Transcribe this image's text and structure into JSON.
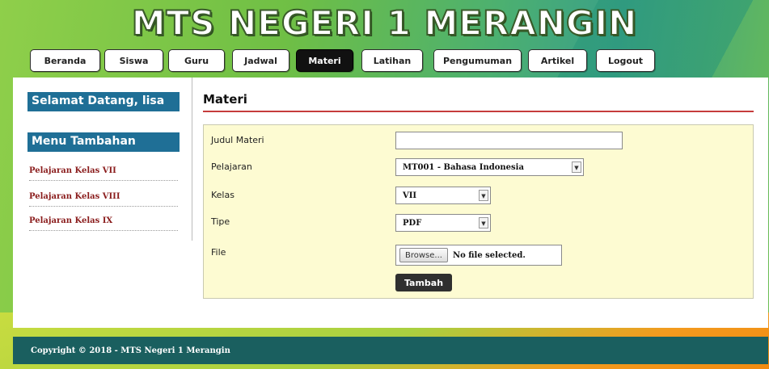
{
  "site": {
    "title": "MTS NEGERI 1 MERANGIN"
  },
  "nav": {
    "items": [
      "Beranda",
      "Siswa",
      "Guru",
      "Jadwal",
      "Materi",
      "Latihan",
      "Pengumuman",
      "Artikel",
      "Logout"
    ],
    "active": "Materi"
  },
  "sidebar": {
    "welcome": "Selamat Datang, lisa",
    "menu_title": "Menu Tambahan",
    "links": [
      "Pelajaran Kelas VII",
      "Pelajaran Kelas VIII",
      "Pelajaran Kelas IX"
    ]
  },
  "content": {
    "title": "Materi",
    "form": {
      "judul_label": "Judul Materi",
      "judul_value": "",
      "pelajaran_label": "Pelajaran",
      "pelajaran_value": "MT001 - Bahasa Indonesia",
      "kelas_label": "Kelas",
      "kelas_value": "VII",
      "tipe_label": "Tipe",
      "tipe_value": "PDF",
      "file_label": "File",
      "browse_label": "Browse...",
      "file_status": "No file selected.",
      "submit_label": "Tambah"
    }
  },
  "footer": {
    "text": "Copyright © 2018 - MTS Negeri 1 Merangin"
  }
}
